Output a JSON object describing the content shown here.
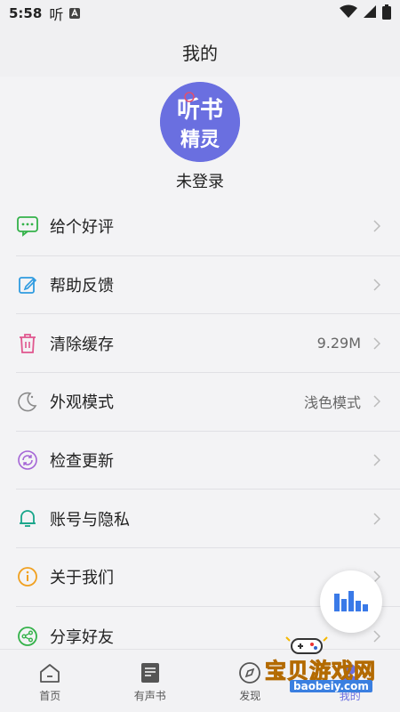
{
  "status_bar": {
    "time": "5:58",
    "app_glyph": "听"
  },
  "header": {
    "title": "我的"
  },
  "profile": {
    "logo_line1": "听书",
    "logo_line2": "精灵",
    "login_label": "未登录"
  },
  "menu": [
    {
      "label": "给个好评",
      "value": "",
      "icon": "comment-icon",
      "color": "#34b24a"
    },
    {
      "label": "帮助反馈",
      "value": "",
      "icon": "edit-icon",
      "color": "#2f9be0"
    },
    {
      "label": "清除缓存",
      "value": "9.29M",
      "icon": "trash-icon",
      "color": "#e0568e"
    },
    {
      "label": "外观模式",
      "value": "浅色模式",
      "icon": "moon-icon",
      "color": "#8a8a8a"
    },
    {
      "label": "检查更新",
      "value": "",
      "icon": "refresh-icon",
      "color": "#a565d6"
    },
    {
      "label": "账号与隐私",
      "value": "",
      "icon": "bell-icon",
      "color": "#17a58a"
    },
    {
      "label": "关于我们",
      "value": "",
      "icon": "info-icon",
      "color": "#f0a020"
    },
    {
      "label": "分享好友",
      "value": "",
      "icon": "share-icon",
      "color": "#34b24a"
    }
  ],
  "tabs": [
    {
      "label": "首页",
      "icon": "home-icon"
    },
    {
      "label": "有声书",
      "icon": "audiobook-icon"
    },
    {
      "label": "发现",
      "icon": "discover-icon"
    },
    {
      "label": "我的",
      "icon": "profile-icon"
    }
  ],
  "watermark": {
    "title": "宝贝游戏网",
    "url": "baobeiy.com"
  },
  "colors": {
    "accent": "#6a6fe0"
  }
}
